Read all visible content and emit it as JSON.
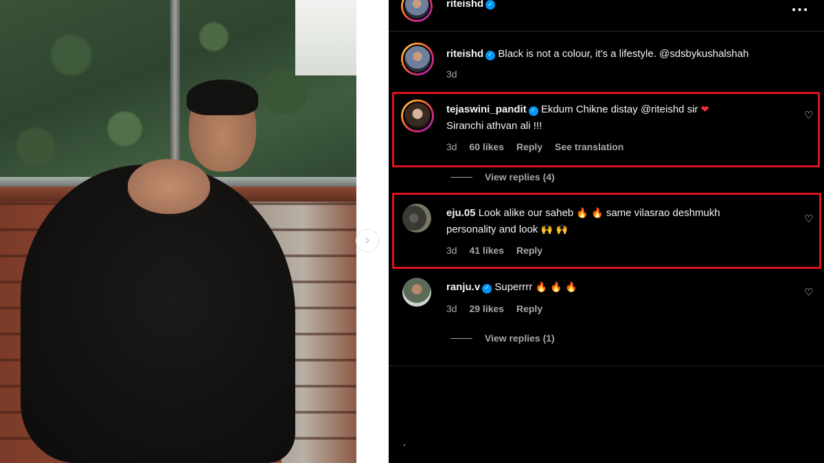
{
  "post": {
    "next_arrow_icon": "chevron-right-icon",
    "next_arrow_glyph": "›"
  },
  "header": {
    "username": "riteishd",
    "verified_glyph": "✓",
    "more_glyph": "···"
  },
  "caption": {
    "username": "riteishd",
    "text": "Black is not a colour, it's a lifestyle. @sdsbykushalshah",
    "time": "3d"
  },
  "comments": [
    {
      "username": "tejaswini_pandit",
      "verified": true,
      "text_before_emoji": "Ekdum Chikne distay @riteishd sir",
      "emoji": "❤",
      "text_line2": "Siranchi athvan ali !!!",
      "time": "3d",
      "likes": "60 likes",
      "reply": "Reply",
      "translate": "See translation",
      "view_replies": "View replies (4)",
      "highlighted": true
    },
    {
      "username": "eju.05",
      "verified": false,
      "text_line1_a": "Look alike our saheb",
      "emoji_fire": "🔥 🔥",
      "text_line1_b": "same vilasrao deshmukh",
      "text_line2": "personality and look",
      "emoji_hands": "🙌 🙌",
      "time": "3d",
      "likes": "41 likes",
      "reply": "Reply",
      "highlighted": true
    },
    {
      "username": "ranju.v",
      "verified": true,
      "text": "Superrrr",
      "emoji_fire": "🔥 🔥 🔥",
      "time": "3d",
      "likes": "29 likes",
      "reply": "Reply",
      "view_replies": "View replies (1)"
    }
  ],
  "icons": {
    "heart_outline": "♡"
  },
  "colors": {
    "highlight": "#e0141c",
    "panel_bg": "#000000",
    "verified_blue": "#0095f6",
    "meta_gray": "#a8a8a8"
  }
}
